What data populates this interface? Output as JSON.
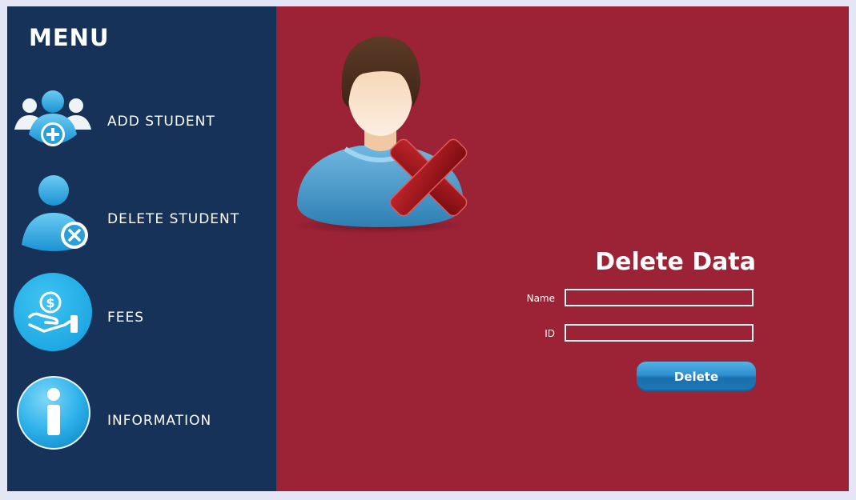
{
  "sidebar": {
    "title": "MENU",
    "items": [
      {
        "label": "ADD STUDENT",
        "icon": "add-student-icon"
      },
      {
        "label": "DELETE STUDENT",
        "icon": "delete-student-icon"
      },
      {
        "label": "FEES",
        "icon": "fees-icon"
      },
      {
        "label": "INFORMATION",
        "icon": "information-icon"
      }
    ]
  },
  "main": {
    "hero_icon": "user-remove-icon",
    "form": {
      "title": "Delete Data",
      "name_label": "Name",
      "name_value": "",
      "id_label": "ID",
      "id_value": "",
      "button_label": "Delete"
    }
  },
  "colors": {
    "sidebar_bg": "#163259",
    "main_bg": "#9c2235",
    "accent_blue": "#2ea4dd",
    "button_blue": "#1e76b4"
  }
}
